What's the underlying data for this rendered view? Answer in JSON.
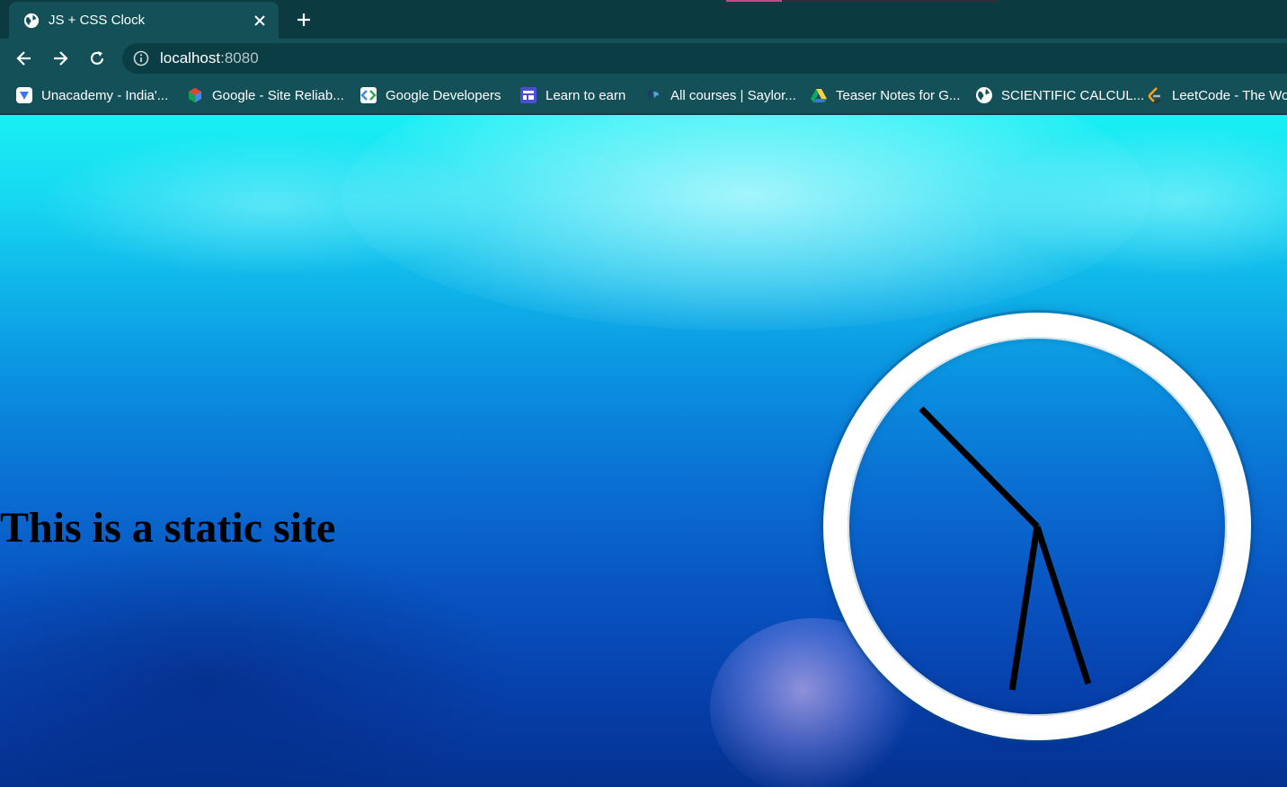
{
  "tab": {
    "title": "JS + CSS Clock",
    "favicon": "globe-icon"
  },
  "toolbar": {
    "url_host": "localhost",
    "url_port": ":8080"
  },
  "bookmarks": [
    {
      "label": "Unacademy - India'...",
      "icon": "unacademy-icon"
    },
    {
      "label": "Google - Site Reliab...",
      "icon": "google-cloud-icon"
    },
    {
      "label": "Google Developers",
      "icon": "google-developers-icon"
    },
    {
      "label": "Learn to earn",
      "icon": "learn-icon"
    },
    {
      "label": "All courses | Saylor...",
      "icon": "saylor-icon"
    },
    {
      "label": "Teaser Notes for G...",
      "icon": "google-drive-icon"
    },
    {
      "label": "SCIENTIFIC CALCUL...",
      "icon": "globe-icon"
    },
    {
      "label": "LeetCode - The Wo",
      "icon": "leetcode-icon"
    }
  ],
  "page": {
    "heading": "This is a static site"
  },
  "clock": {
    "hour": 10,
    "minute": 31,
    "second": 27
  },
  "colors": {
    "tab_bg": "#135058",
    "strip_bg": "#0b3a41",
    "hand": "#000000",
    "face_border": "#ffffff"
  }
}
